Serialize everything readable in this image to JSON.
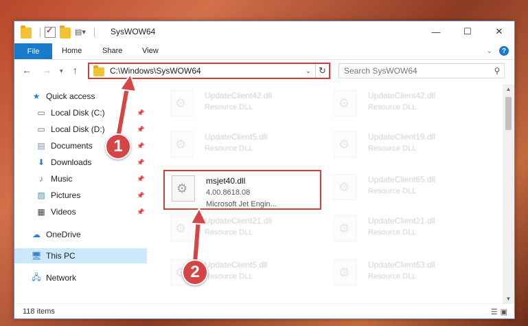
{
  "window": {
    "title": "SysWOW64",
    "controls": [
      "—",
      "☐",
      "✕"
    ]
  },
  "ribbon": {
    "tabs": [
      "File",
      "Home",
      "Share",
      "View"
    ]
  },
  "nav": {
    "address": "C:\\Windows\\SysWOW64",
    "search_placeholder": "Search SysWOW64"
  },
  "sidebar": {
    "items": [
      {
        "label": "Quick access",
        "icon": "star-icon"
      },
      {
        "label": "Local Disk (C:)",
        "icon": "drive-icon"
      },
      {
        "label": "Local Disk (D:)",
        "icon": "drive-icon"
      },
      {
        "label": "Documents",
        "icon": "documents-icon"
      },
      {
        "label": "Downloads",
        "icon": "downloads-icon"
      },
      {
        "label": "Music",
        "icon": "music-icon"
      },
      {
        "label": "Pictures",
        "icon": "pictures-icon"
      },
      {
        "label": "Videos",
        "icon": "videos-icon"
      },
      {
        "label": "OneDrive",
        "icon": "cloud-icon"
      },
      {
        "label": "This PC",
        "icon": "computer-icon"
      },
      {
        "label": "Network",
        "icon": "network-icon"
      }
    ]
  },
  "files": {
    "left": [
      {
        "name": "UpdateClient42.dll",
        "type": "Resource DLL"
      },
      {
        "name": "UpdateClient5.dll",
        "type": "Resource DLL"
      },
      {
        "name": "msjet40.dll",
        "version": "4.00.8618.08",
        "desc": "Microsoft Jet Engin..."
      },
      {
        "name": "UpdateClient21.dll",
        "type": "Resource DLL"
      },
      {
        "name": "UpdateClient5.dll",
        "type": "Resource DLL"
      }
    ],
    "right": [
      {
        "name": "UpdateClient42.dll",
        "type": "Resource DLL"
      },
      {
        "name": "UpdateClient19.dll",
        "type": "Resource DLL"
      },
      {
        "name": "UpdateClient65.dll",
        "type": "Resource DLL"
      },
      {
        "name": "UpdateClient21.dll",
        "type": "Resource DLL"
      },
      {
        "name": "UpdateClient63.dll",
        "type": "Resource DLL"
      }
    ]
  },
  "status": {
    "item_count": "118 items"
  },
  "annotations": {
    "step1": "1",
    "step2": "2",
    "callout_color": "#d64545",
    "highlight_color": "#d93a3a"
  }
}
